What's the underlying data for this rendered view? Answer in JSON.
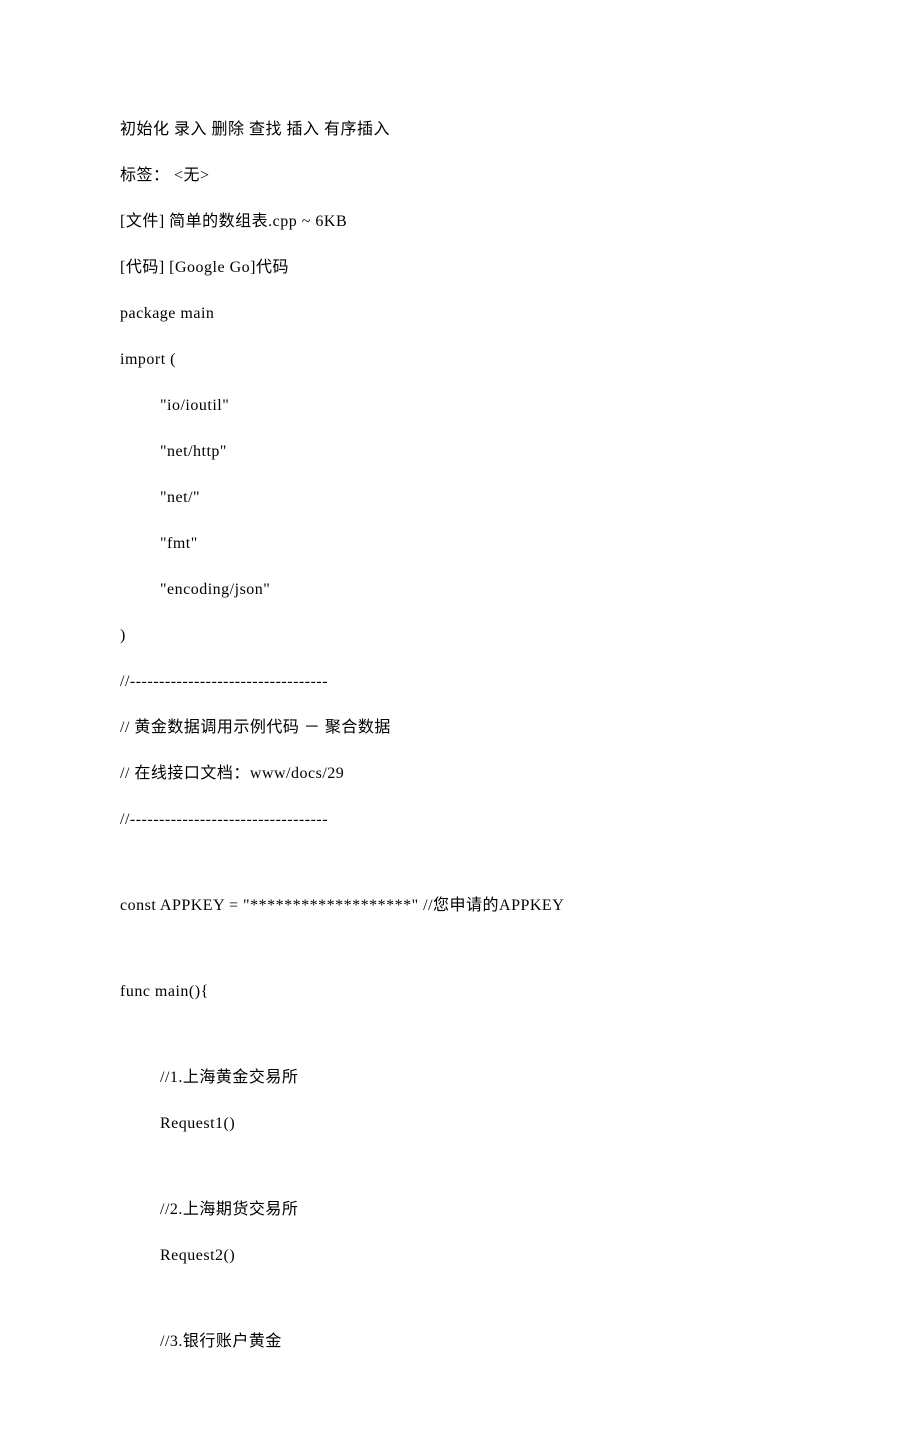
{
  "lines": {
    "l1": "初始化 录入 删除 查找 插入 有序插入",
    "l2": "标签： <无>",
    "l3": "[文件] 简单的数组表.cpp ~ 6KB",
    "l4": "[代码] [Google Go]代码",
    "l5": "package main",
    "l6": "import (",
    "l7": "\"io/ioutil\"",
    "l8": "\"net/http\"",
    "l9": "\"net/\"",
    "l10": "\"fmt\"",
    "l11": "\"encoding/json\"",
    "l12": ")",
    "l13": "//----------------------------------",
    "l14": "// 黄金数据调用示例代码 － 聚合数据",
    "l15": "// 在线接口文档：www/docs/29",
    "l16": "//----------------------------------",
    "l17": "const APPKEY = \"*******************\" //您申请的APPKEY",
    "l18": "func main(){",
    "l19": "//1.上海黄金交易所",
    "l20": "Request1()",
    "l21": "//2.上海期货交易所",
    "l22": "Request2()",
    "l23": "//3.银行账户黄金"
  }
}
